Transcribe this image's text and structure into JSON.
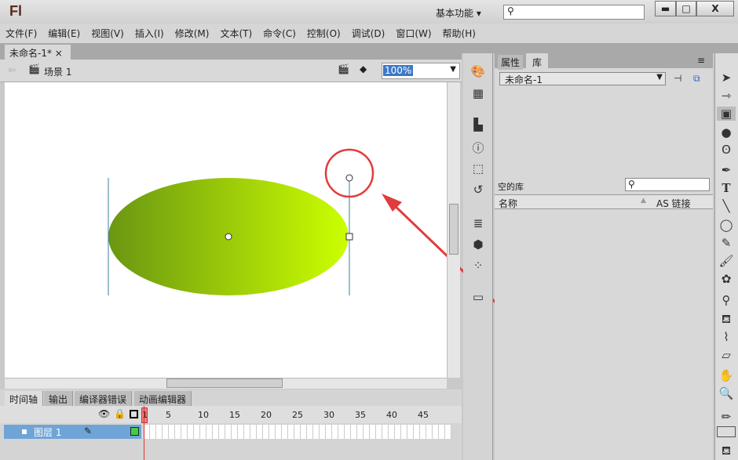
{
  "app": {
    "logo": "Fl",
    "workspace": "基本功能",
    "workspace_arrow": "▾",
    "minimize": "▬",
    "maximize": "□",
    "close": "X"
  },
  "menu": [
    "文件(F)",
    "编辑(E)",
    "视图(V)",
    "插入(I)",
    "修改(M)",
    "文本(T)",
    "命令(C)",
    "控制(O)",
    "调试(D)",
    "窗口(W)",
    "帮助(H)"
  ],
  "document": {
    "tab": "未命名-1*",
    "tab_close": "×",
    "scene": "场景 1",
    "zoom": "100%"
  },
  "timeline": {
    "tabs": [
      "时间轴",
      "输出",
      "编译器错误",
      "动画编辑器"
    ],
    "frame_numbers": [
      "1",
      "5",
      "10",
      "15",
      "20",
      "25",
      "30",
      "35",
      "40",
      "45"
    ],
    "layer": "图层 1"
  },
  "library": {
    "tabs": [
      "属性",
      "库"
    ],
    "doc_select": "未命名-1",
    "empty_label": "空的库",
    "col_name": "名称",
    "col_linkage": "AS 链接"
  },
  "colors": {
    "fill_start": "#6a9612",
    "fill_end": "#ccff00",
    "annotation": "#e03c3c"
  }
}
